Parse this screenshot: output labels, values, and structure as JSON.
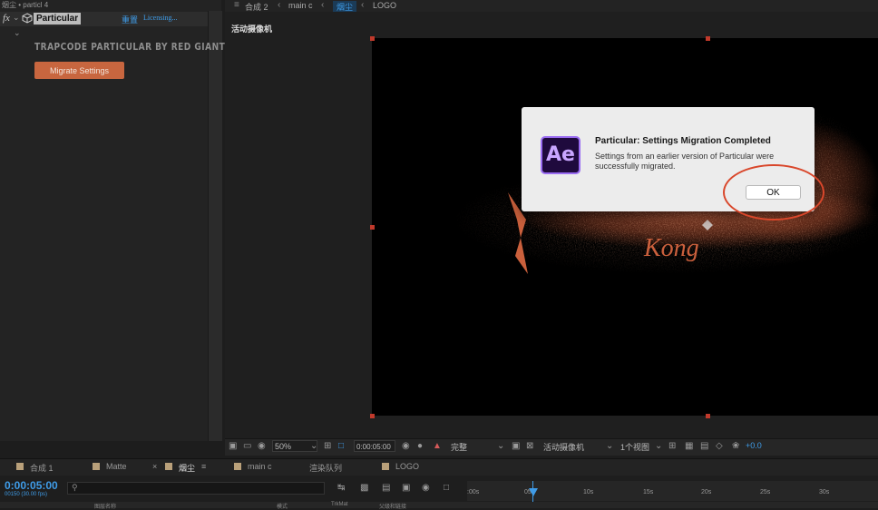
{
  "effect_panel": {
    "tab_title": "烟尘 • particl 4",
    "fx_label": "fx",
    "effect_name": "Particular",
    "reset_label": "重置",
    "licensing_label": "Licensing...",
    "plugin_title": "TRAPCODE PARTICULAR BY RED GIANT",
    "migrate_button": "Migrate Settings"
  },
  "viewer": {
    "breadcrumbs": [
      "合成 2",
      "main c",
      "烟尘",
      "LOGO"
    ],
    "active_breadcrumb": "烟尘",
    "camera_label": "活动摄像机",
    "comp_text": "Kong"
  },
  "dialog": {
    "icon_text": "Ae",
    "title": "Particular: Settings Migration Completed",
    "message": "Settings from an earlier version of Particular were successfully migrated.",
    "ok_label": "OK",
    "highlight_color": "#d9472b"
  },
  "viewer_toolbar": {
    "zoom": "50%",
    "timecode": "0:00:05:00",
    "resolution": "完整",
    "camera": "活动摄像机",
    "views": "1个视图",
    "exposure": "+0.0"
  },
  "timeline": {
    "tabs": [
      "合成 1",
      "Matte",
      "烟尘",
      "main c",
      "渲染队列",
      "LOGO"
    ],
    "active_tab": "烟尘",
    "current_time": "0:00:05:00",
    "frame_info": "00150 (30.00 fps)",
    "search_placeholder": "",
    "ruler_labels": [
      ":00s",
      "05s",
      "10s",
      "15s",
      "20s",
      "25s",
      "30s"
    ],
    "column_layer_name": "图层名称",
    "column_mode": "模式",
    "column_trkmat": "TrkMat",
    "column_parent": "父级和链接"
  },
  "colors": {
    "accent": "#3f9ce8",
    "migrate_button": "#c8663f",
    "particles": "#e06a43"
  }
}
